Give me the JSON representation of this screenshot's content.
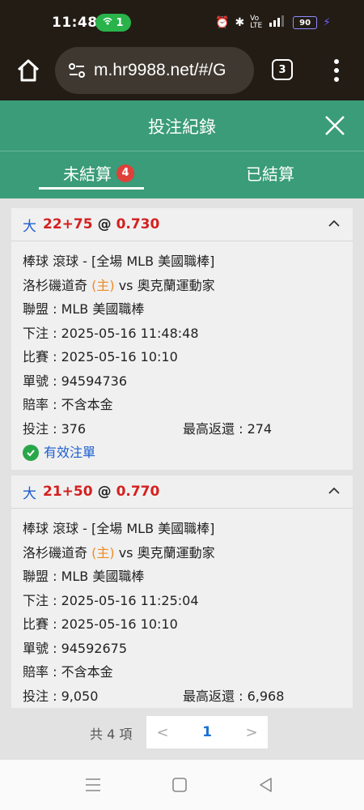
{
  "status": {
    "time": "11:48",
    "hotspot_count": "1",
    "battery": "90"
  },
  "browser": {
    "url": "m.hr9988.net/#/G",
    "tab_count": "3"
  },
  "header": {
    "title": "投注紀錄"
  },
  "tabs": [
    {
      "label": "未結算",
      "badge": "4"
    },
    {
      "label": "已結算"
    }
  ],
  "bets": [
    {
      "side": "大",
      "line": "22+75",
      "at": "@",
      "odds": "0.730",
      "sport_line": "棒球 滾球 - [全場 MLB 美國職棒]",
      "home_team": "洛杉磯道奇",
      "home_tag": "(主)",
      "vs": "vs",
      "away_team": "奧克蘭運動家",
      "league": "聯盟 : MLB 美國職棒",
      "placed": "下注 : 2025-05-16 11:48:48",
      "match_time": "比賽 : 2025-05-16 10:10",
      "ticket": "單號 : 94594736",
      "odds_type": "賠率 : 不含本金",
      "stake": "投注 : 376",
      "max_return": "最高返還 : 274",
      "status": "有效注單"
    },
    {
      "side": "大",
      "line": "21+50",
      "at": "@",
      "odds": "0.770",
      "sport_line": "棒球 滾球 - [全場 MLB 美國職棒]",
      "home_team": "洛杉磯道奇",
      "home_tag": "(主)",
      "vs": "vs",
      "away_team": "奧克蘭運動家",
      "league": "聯盟 : MLB 美國職棒",
      "placed": "下注 : 2025-05-16 11:25:04",
      "match_time": "比賽 : 2025-05-16 10:10",
      "ticket": "單號 : 94592675",
      "odds_type": "賠率 : 不含本金",
      "stake": "投注 : 9,050",
      "max_return": "最高返還 : 6,968"
    }
  ],
  "pagination": {
    "total": "共 4 項",
    "prev": "<",
    "page": "1",
    "next": ">"
  },
  "colors": {
    "header_green": "#3a9c78",
    "red": "#d42020",
    "blue": "#1d5fd1",
    "orange": "#f08a1f",
    "badge_red": "#e0403a"
  },
  "icons": [
    "home-icon",
    "site-settings-icon",
    "tabs-icon",
    "overflow-menu-icon",
    "close-icon",
    "chevron-up-icon",
    "check-circle-icon",
    "nav-menu-icon",
    "nav-home-icon",
    "nav-back-icon"
  ]
}
